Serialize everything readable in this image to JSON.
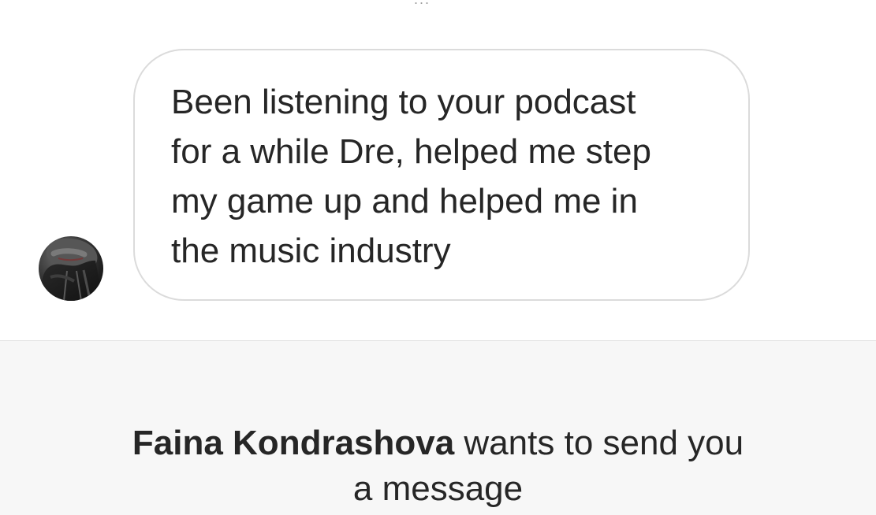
{
  "conversation": {
    "previous_fragment": "...",
    "message_text": "Been listening to your podcast\nfor a while Dre, helped me step\nmy game up and helped me in\nthe music industry"
  },
  "request": {
    "sender_name": "Faina Kondrashova",
    "prompt_line_1": " wants to send you",
    "prompt_line_2": "a message"
  },
  "colors": {
    "bubble_border": "#dbdbdb",
    "panel_background": "#f7f7f7",
    "text": "#262626"
  }
}
